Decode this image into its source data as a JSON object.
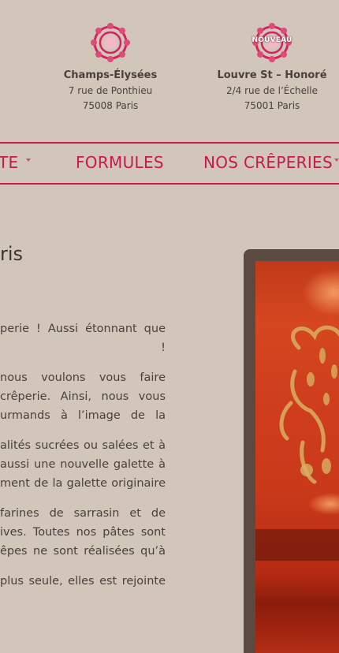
{
  "locations": [
    {
      "name": "Champs-Élysées",
      "street": "7 rue de Ponthieu",
      "city": "75008 Paris",
      "badge": "",
      "logo_icon": "flower-logo-icon"
    },
    {
      "name": "Louvre St – Honoré",
      "street": "2/4 rue de l’Échelle",
      "city": "75001 Paris",
      "badge": "NOUVEAU",
      "logo_icon": "flower-logo-icon"
    }
  ],
  "nav": {
    "items": [
      {
        "label": "TE"
      },
      {
        "label": "FORMULES"
      },
      {
        "label": "NOS CRÊPERIES"
      }
    ]
  },
  "main": {
    "heading": "ris",
    "paragraphs": [
      [
        "perie ! Aussi étonnant que",
        "!"
      ],
      [
        "nous voulons vous faire",
        "crêperie. Ainsi, nous vous",
        "urmands à l’image de la"
      ],
      [
        "alités sucrées ou salées et à",
        "aussi une nouvelle galette à",
        "ment de la galette originaire"
      ],
      [
        "farines de sarrasin et de",
        "ives. Toutes nos pâtes sont",
        "êpes ne sont réalisées qu’à"
      ],
      [
        "plus seule, elles est rejointe"
      ]
    ]
  },
  "colors": {
    "background": "#d1c6b9",
    "accent": "#c8184e",
    "text": "#3b3432",
    "frame": "#5a4a40"
  }
}
